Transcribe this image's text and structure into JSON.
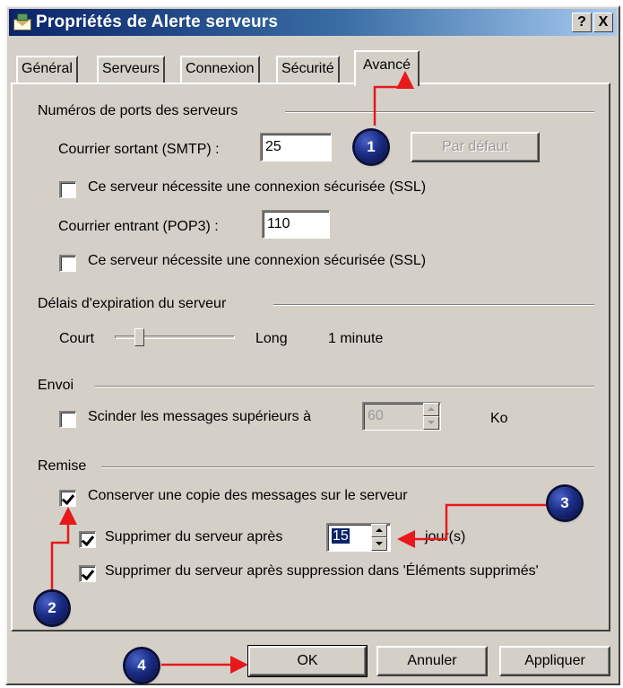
{
  "window": {
    "title": "Propriétés de Alerte serveurs",
    "help_button": "?",
    "close_button": "X"
  },
  "tabs": [
    {
      "label": "Général",
      "active": false
    },
    {
      "label": "Serveurs",
      "active": false
    },
    {
      "label": "Connexion",
      "active": false
    },
    {
      "label": "Sécurité",
      "active": false
    },
    {
      "label": "Avancé",
      "active": true
    }
  ],
  "ports": {
    "group_label": "Numéros de ports des serveurs",
    "smtp_label": "Courrier sortant (SMTP) :",
    "smtp_value": "25",
    "default_button": "Par défaut",
    "smtp_ssl_label": "Ce serveur nécessite une connexion sécurisée (SSL)",
    "smtp_ssl_checked": false,
    "pop3_label": "Courrier entrant (POP3) :",
    "pop3_value": "110",
    "pop3_ssl_label": "Ce serveur nécessite une connexion sécurisée (SSL)",
    "pop3_ssl_checked": false
  },
  "timeout": {
    "group_label": "Délais d'expiration du serveur",
    "short_label": "Court",
    "long_label": "Long",
    "value_label": "1 minute",
    "slider_fraction": 0.18
  },
  "sending": {
    "group_label": "Envoi",
    "split_label": "Scinder les messages supérieurs à",
    "split_checked": false,
    "split_value": "60",
    "unit": "Ko"
  },
  "delivery": {
    "group_label": "Remise",
    "keep_copy_label": "Conserver une copie des messages sur le serveur",
    "keep_copy_checked": true,
    "delete_after_label": "Supprimer du serveur après",
    "delete_after_checked": true,
    "days_value": "15",
    "days_unit": "jour(s)",
    "delete_on_trash_label": "Supprimer du serveur après suppression dans 'Éléments supprimés'",
    "delete_on_trash_checked": true
  },
  "buttons": {
    "ok": "OK",
    "cancel": "Annuler",
    "apply": "Appliquer"
  },
  "markers": [
    "1",
    "2",
    "3",
    "4"
  ],
  "colors": {
    "arrow": "#e8181d",
    "marker": "#1b2d86",
    "title_start": "#0a246a",
    "title_end": "#a6caf0",
    "dialog_bg": "#d4d0c8"
  }
}
